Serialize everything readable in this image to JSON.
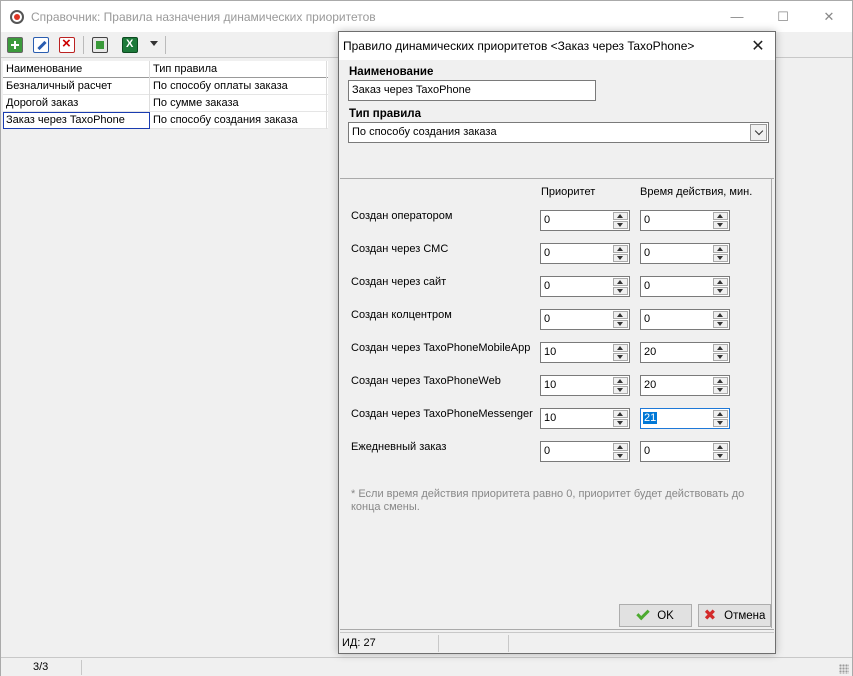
{
  "window": {
    "title": "Справочник: Правила назначения динамических приоритетов",
    "minimize_glyph": "—",
    "maximize_glyph": "☐",
    "close_glyph": "✕"
  },
  "toolbar": {
    "buttons": [
      {
        "name": "add-record-button",
        "icon": "add-icon"
      },
      {
        "name": "edit-record-button",
        "icon": "edit-icon"
      },
      {
        "name": "delete-record-button",
        "icon": "delete-icon"
      },
      {
        "name": "properties-button",
        "icon": "properties-icon"
      },
      {
        "name": "export-excel-button",
        "icon": "excel-icon"
      }
    ]
  },
  "grid": {
    "columns": [
      "Наименование",
      "Тип правила"
    ],
    "rows": [
      [
        "Безналичный расчет",
        "По способу оплаты заказа"
      ],
      [
        "Дорогой заказ",
        "По сумме заказа"
      ],
      [
        "Заказ через TaxoPhone",
        "По способу создания заказа"
      ]
    ]
  },
  "statusbar": {
    "count": "3/3"
  },
  "dialog": {
    "title": "Правило динамических приоритетов <Заказ через TaxoPhone>",
    "close_glyph": "✕",
    "name_label": "Наименование",
    "name_value": "Заказ через TaxoPhone",
    "type_label": "Тип правила",
    "type_value": "По способу создания заказа",
    "col_priority": "Приоритет",
    "col_duration": "Время действия, мин.",
    "rows": [
      {
        "label": "Создан оператором",
        "priority": "0",
        "duration": "0"
      },
      {
        "label": "Создан через СМС",
        "priority": "0",
        "duration": "0"
      },
      {
        "label": "Создан через сайт",
        "priority": "0",
        "duration": "0"
      },
      {
        "label": "Создан колцентром",
        "priority": "0",
        "duration": "0"
      },
      {
        "label": "Создан через TaxoPhoneMobileApp",
        "priority": "10",
        "duration": "20"
      },
      {
        "label": "Создан через TaxoPhoneWeb",
        "priority": "10",
        "duration": "20"
      },
      {
        "label": "Создан через TaxoPhoneMessenger",
        "priority": "10",
        "duration": "21"
      },
      {
        "label": "Ежедневный заказ",
        "priority": "0",
        "duration": "0"
      }
    ],
    "note": "* Если время действия приоритета равно 0, приоритет будет действовать до конца смены.",
    "ok_label": "OK",
    "cancel_label": "Отмена",
    "status_id": "ИД: 27"
  }
}
